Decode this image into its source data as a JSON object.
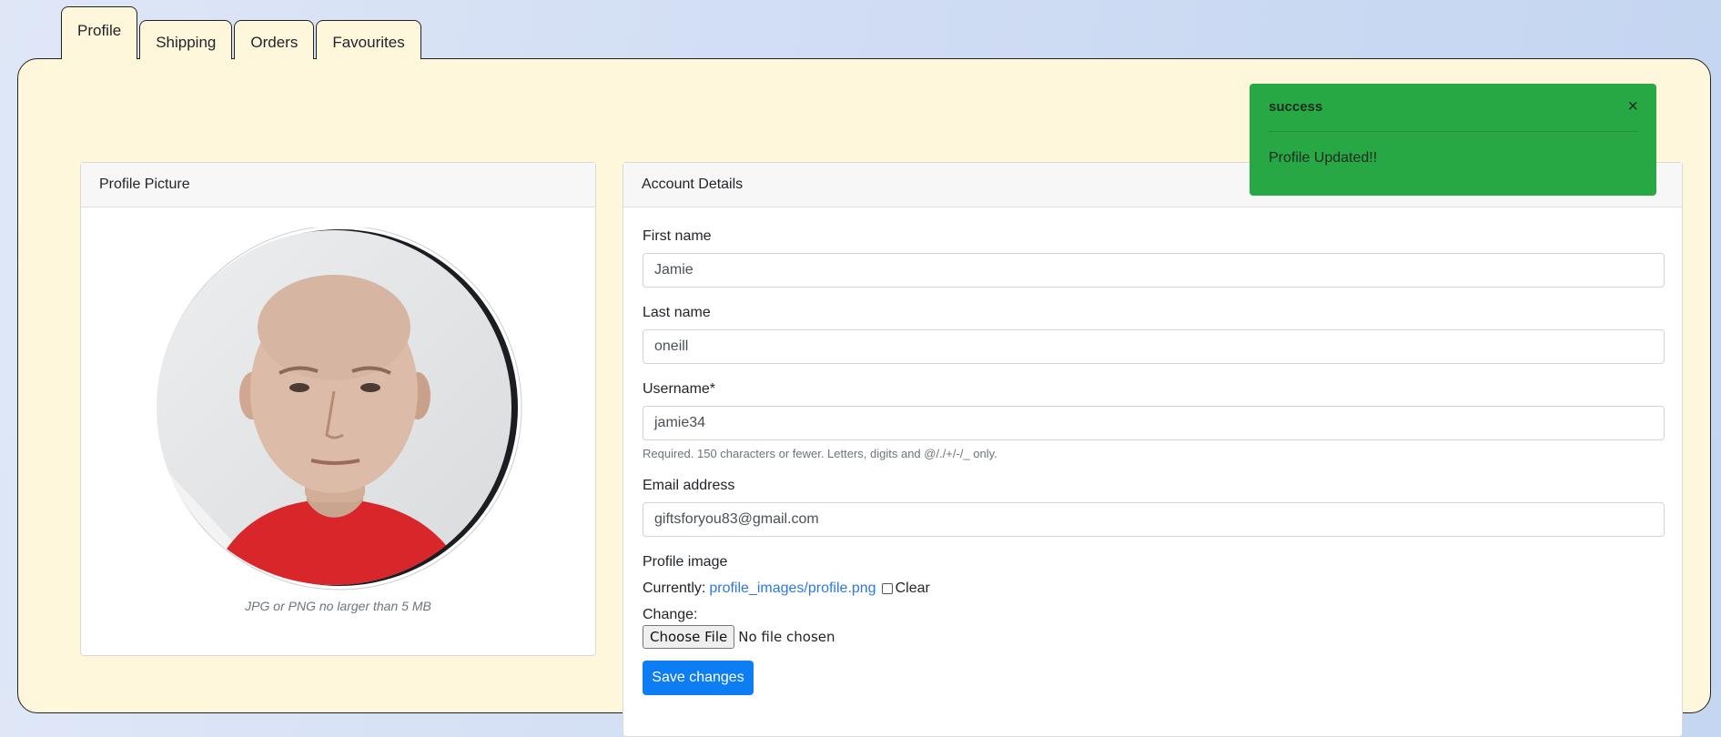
{
  "tabs": [
    {
      "label": "Profile",
      "active": true
    },
    {
      "label": "Shipping",
      "active": false
    },
    {
      "label": "Orders",
      "active": false
    },
    {
      "label": "Favourites",
      "active": false
    }
  ],
  "profile_picture": {
    "header": "Profile Picture",
    "caption": "JPG or PNG no larger than 5 MB"
  },
  "account": {
    "header": "Account Details",
    "first_name": {
      "label": "First name",
      "value": "Jamie"
    },
    "last_name": {
      "label": "Last name",
      "value": "oneill"
    },
    "username": {
      "label": "Username*",
      "value": "jamie34",
      "help": "Required. 150 characters or fewer. Letters, digits and @/./+/-/_ only."
    },
    "email": {
      "label": "Email address",
      "value": "giftsforyou83@gmail.com"
    },
    "profile_image": {
      "label": "Profile image",
      "currently_label": "Currently:",
      "current_link": "profile_images/profile.png",
      "clear_label": "Clear",
      "change_label": "Change:",
      "choose_file_label": "Choose File",
      "no_file_label": "No file chosen"
    },
    "save_label": "Save changes"
  },
  "toast": {
    "title": "success",
    "close_glyph": "×",
    "message": "Profile Updated!!",
    "color": "#28a745"
  },
  "colors": {
    "panel": "#fef7dc",
    "primary": "#0d7df4",
    "link": "#2a7ae2"
  }
}
